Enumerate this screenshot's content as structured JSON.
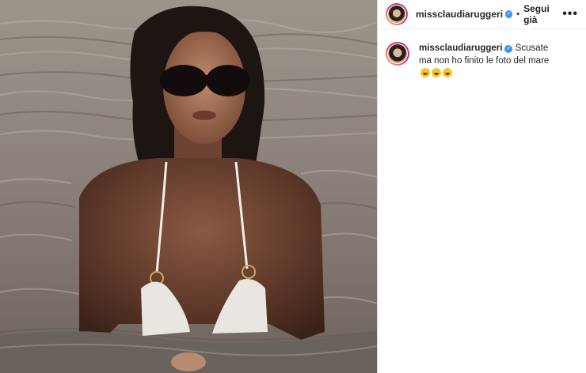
{
  "post": {
    "username": "missclaudiaruggeri",
    "follow_status": "Segui già",
    "more_label": "•••",
    "separator": "•",
    "verified_icon": "verified-badge-icon"
  },
  "caption": {
    "username": "missclaudiaruggeri",
    "text": "Scusate ma non ho finito le foto del mare",
    "emojis": [
      "grinning-face-emoji",
      "grinning-face-emoji",
      "grinning-face-emoji"
    ]
  },
  "colors": {
    "verified": "#3897f0",
    "border": "#dbdbdb",
    "text": "#262626"
  }
}
